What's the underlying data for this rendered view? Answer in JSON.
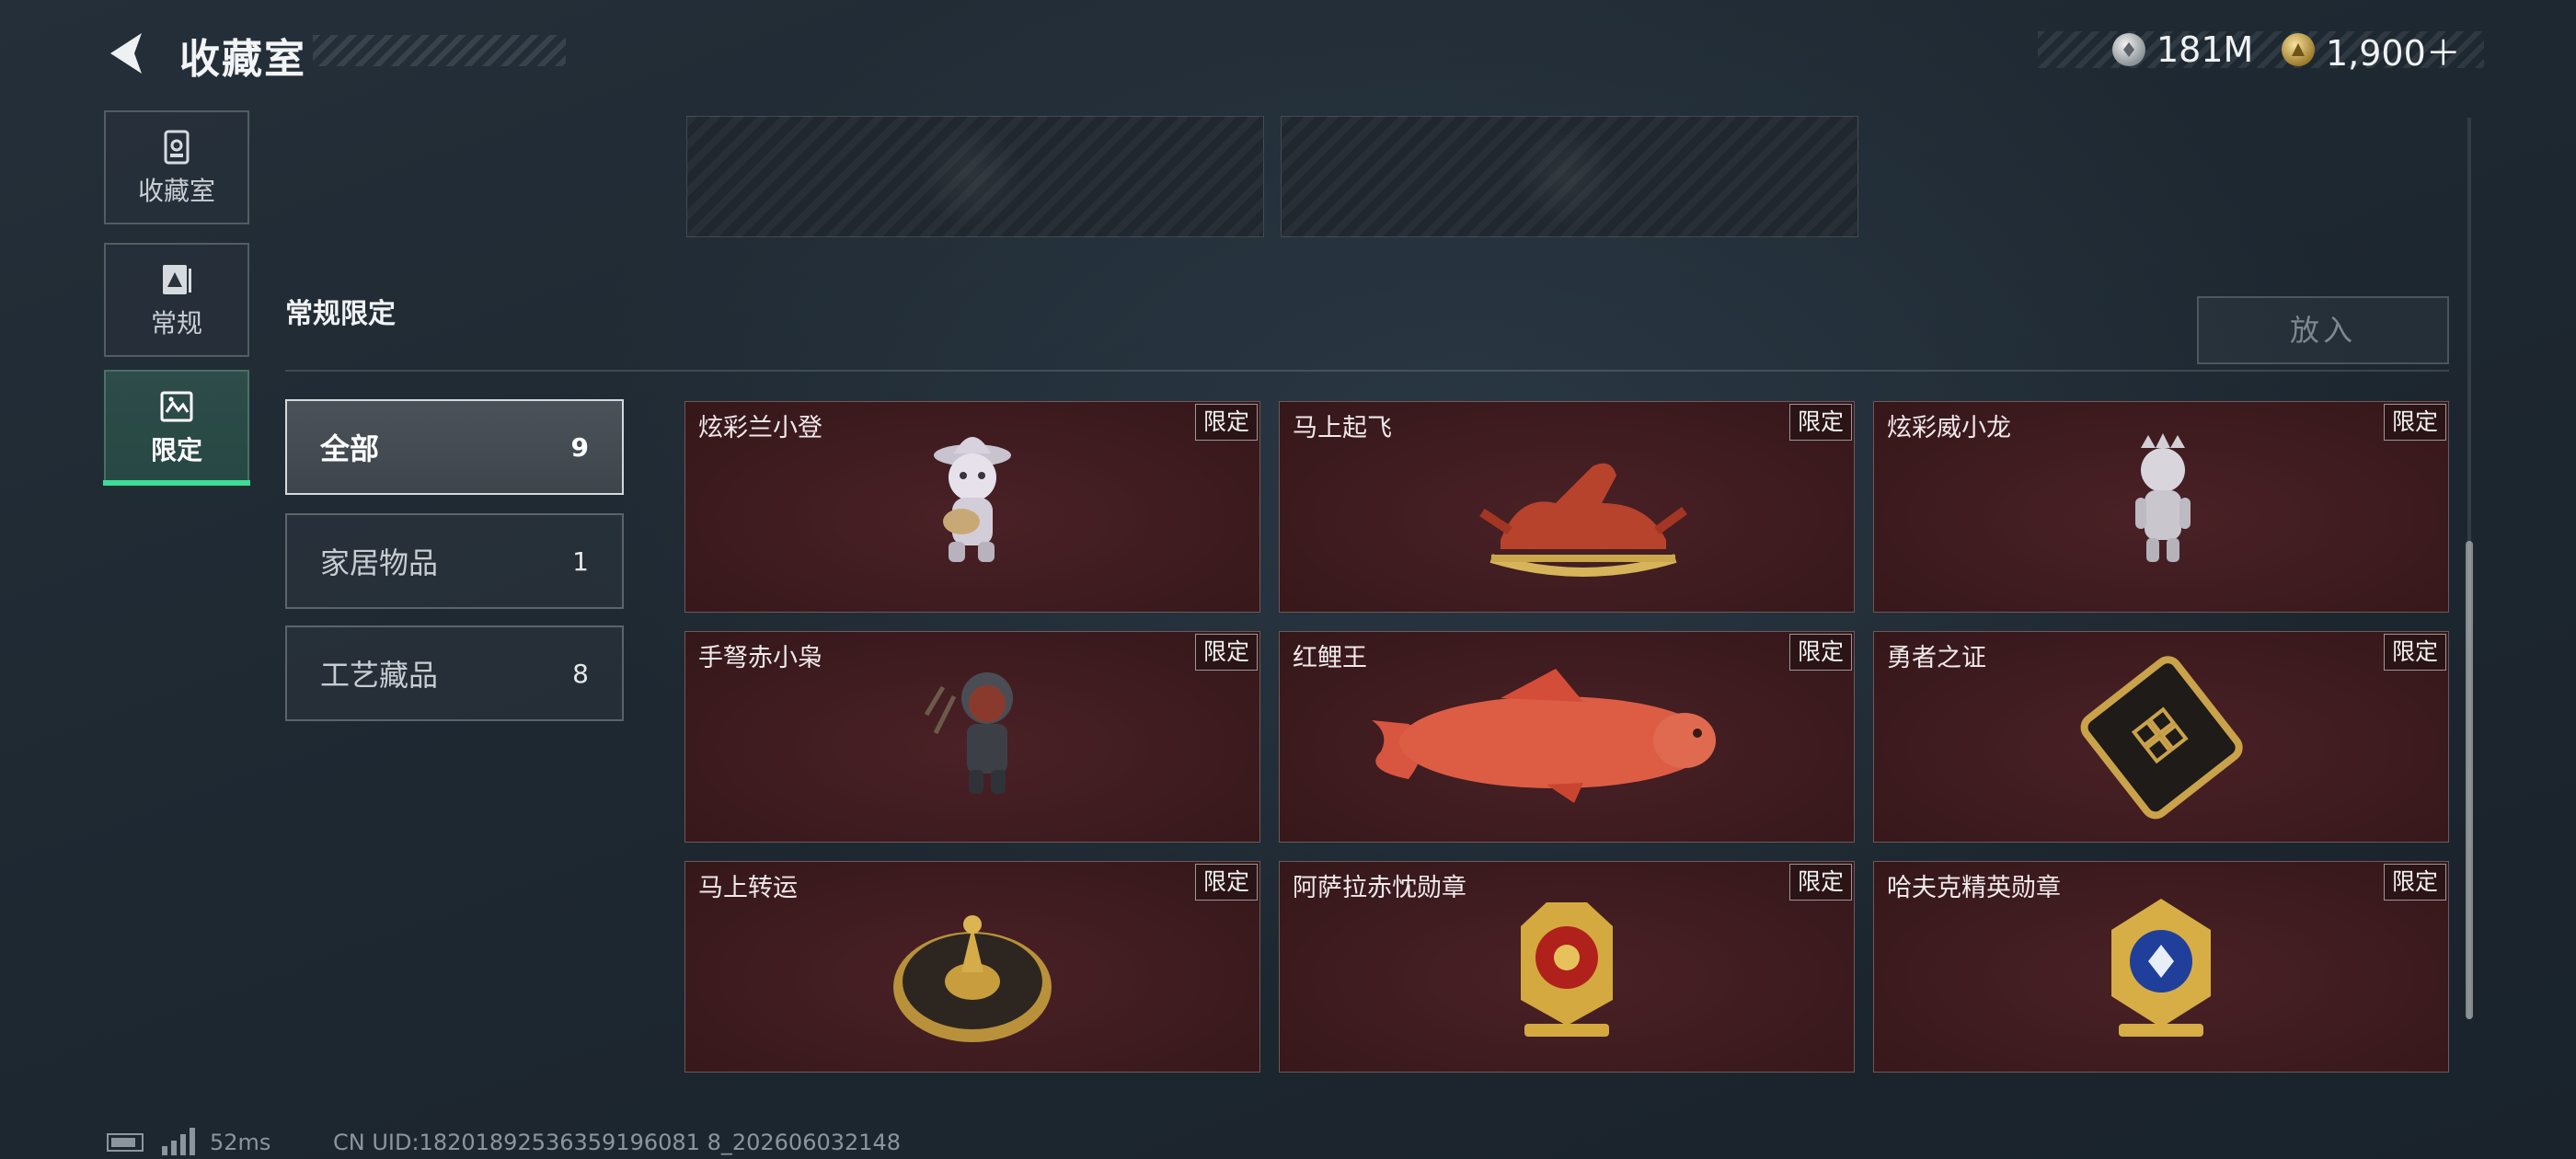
{
  "header": {
    "title": "收藏室",
    "currency": [
      {
        "icon": "silver-coin-icon",
        "value": "181M"
      },
      {
        "icon": "gold-coin-icon",
        "value": "1,900＋"
      }
    ]
  },
  "nav": {
    "items": [
      {
        "label": "收藏室",
        "icon": "collection-room-icon",
        "active": false
      },
      {
        "label": "常规",
        "icon": "regular-icon",
        "active": false
      },
      {
        "label": "限定",
        "icon": "limited-icon",
        "active": true
      }
    ]
  },
  "section": {
    "title": "常规限定",
    "put_in_label": "放入"
  },
  "categories": [
    {
      "label": "全部",
      "count": "9",
      "active": true
    },
    {
      "label": "家居物品",
      "count": "1",
      "active": false
    },
    {
      "label": "工艺藏品",
      "count": "8",
      "active": false
    }
  ],
  "items": [
    {
      "name": "炫彩兰小登",
      "badge": "限定",
      "art": "figurine-sombrero-guitar"
    },
    {
      "name": "马上起飞",
      "badge": "限定",
      "art": "horse-rocking"
    },
    {
      "name": "炫彩威小龙",
      "badge": "限定",
      "art": "figurine-crown"
    },
    {
      "name": "手弩赤小枭",
      "badge": "限定",
      "art": "figurine-hooded-crossbow"
    },
    {
      "name": "红鲤王",
      "badge": "限定",
      "art": "red-carp"
    },
    {
      "name": "勇者之证",
      "badge": "限定",
      "art": "black-gold-card"
    },
    {
      "name": "马上转运",
      "badge": "限定",
      "art": "golden-wheel"
    },
    {
      "name": "阿萨拉赤忱勋章",
      "badge": "限定",
      "art": "red-gold-medal"
    },
    {
      "name": "哈夫克精英勋章",
      "badge": "限定",
      "art": "blue-gold-medal"
    }
  ],
  "colors": {
    "accent": "#3ddc97",
    "card_bg": "#3b1a1e"
  },
  "footer": {
    "ping": "52ms",
    "uid": "CN UID:18201892536359196081 8_202606032148"
  }
}
